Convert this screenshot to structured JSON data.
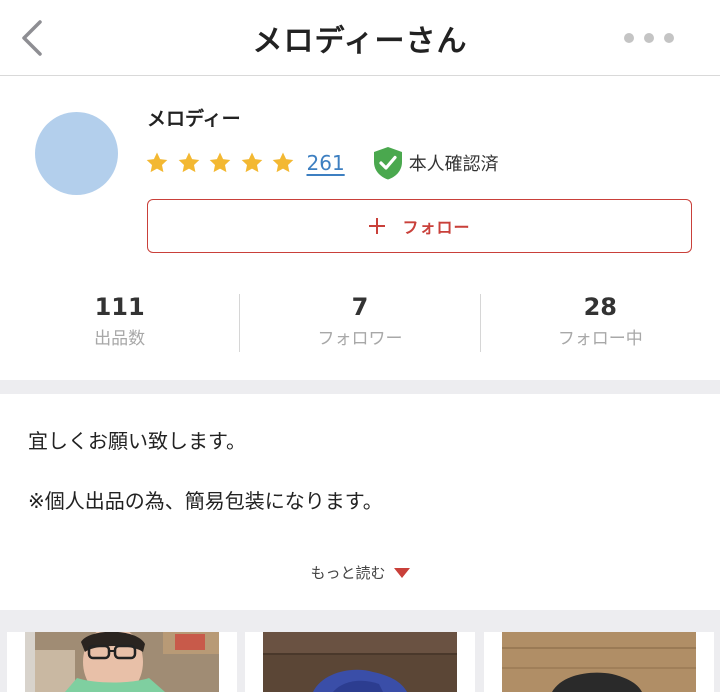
{
  "header": {
    "title": "メロディーさん",
    "back_icon": "chevron-left-icon",
    "more_icon": "more-horizontal-icon"
  },
  "profile": {
    "name": "メロディー",
    "avatar_color": "#b3cfec",
    "rating": {
      "stars": 5,
      "star_color": "#f3b832",
      "count": "261"
    },
    "verified": {
      "label": "本人確認済",
      "color": "#4aa84e"
    },
    "follow_button": {
      "label": "フォロー",
      "color": "#c9403a"
    }
  },
  "stats": [
    {
      "value": "111",
      "label": "出品数"
    },
    {
      "value": "7",
      "label": "フォロワー"
    },
    {
      "value": "28",
      "label": "フォロー中"
    }
  ],
  "intro": {
    "lines": [
      "宜しくお願い致します。",
      "※個人出品の為、簡易包装になります。"
    ],
    "read_more": "もっと読む",
    "read_more_color": "#c9403a"
  },
  "items": [
    {
      "name": "item-photo-person"
    },
    {
      "name": "item-photo-blue-cloth"
    },
    {
      "name": "item-photo-dark-object"
    }
  ]
}
